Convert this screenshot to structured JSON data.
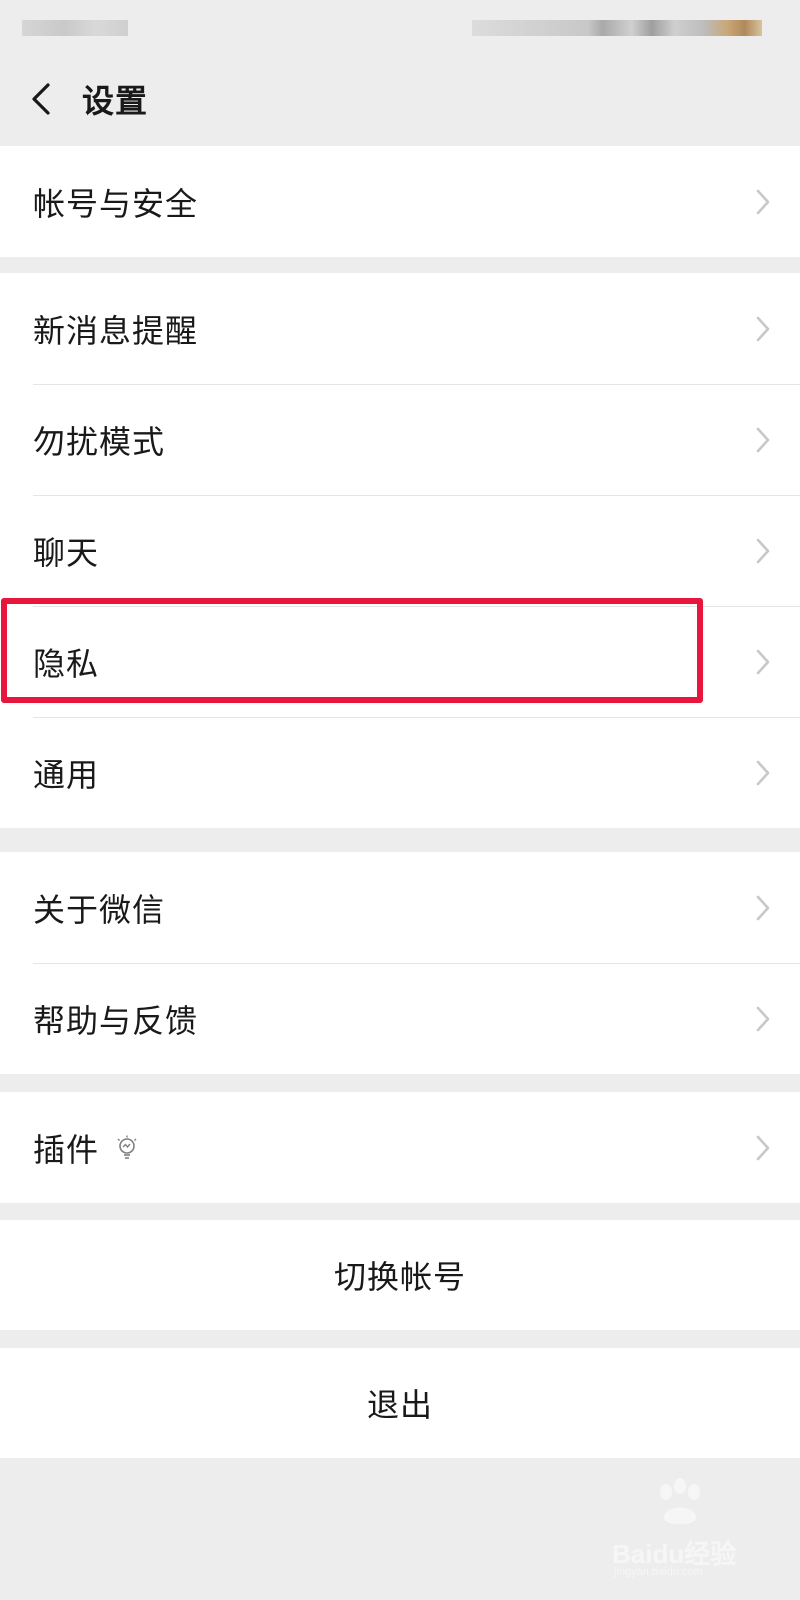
{
  "header": {
    "title": "设置"
  },
  "groups": {
    "account": [
      "帐号与安全"
    ],
    "main": [
      "新消息提醒",
      "勿扰模式",
      "聊天",
      "隐私",
      "通用"
    ],
    "about": [
      "关于微信",
      "帮助与反馈"
    ],
    "plugins": [
      "插件"
    ]
  },
  "actions": {
    "switch_account": "切换帐号",
    "logout": "退出"
  },
  "icons": {
    "back": "chevron-left-icon",
    "row_arrow": "chevron-right-icon",
    "plugin_badge": "lightbulb-icon"
  },
  "colors": {
    "background": "#ededed",
    "cell": "#ffffff",
    "text": "#191919",
    "chevron": "#c7c7cc",
    "highlight": "#e8153c"
  },
  "watermark": {
    "brand": "Baidu经验",
    "domain": "jingyan.baidu.com"
  }
}
